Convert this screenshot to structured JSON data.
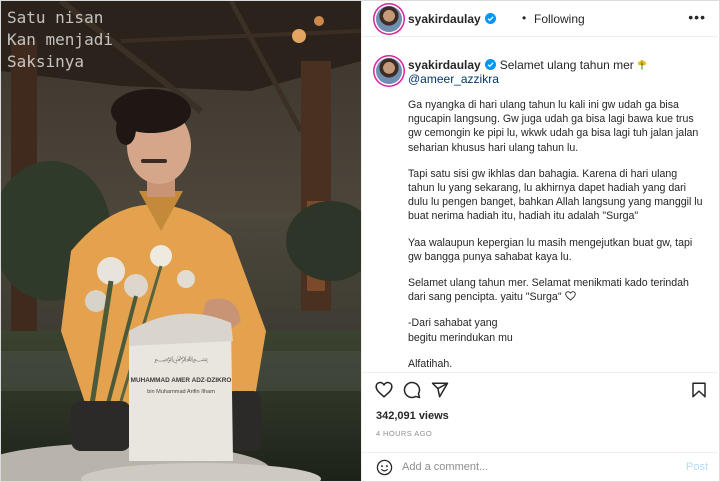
{
  "photo": {
    "overlay_text": "Satu nisan\nKan menjadi\nSaksinya",
    "gravestone_lines": [
      "MUHAMMAD AMER ADZ-DZIKRO",
      "bin Muhammad Arifin Ilham"
    ]
  },
  "header": {
    "username": "syakirdaulay",
    "separator": "•",
    "follow_status": "Following",
    "more": "•••"
  },
  "caption": {
    "username": "syakirdaulay",
    "first_line": "Selamet ulang tahun mer",
    "mention": "@ameer_azzikra",
    "paragraphs": [
      "Ga nyangka di hari ulang tahun lu kali ini gw udah ga bisa ngucapin langsung. Gw juga udah ga bisa lagi bawa kue trus gw cemongin ke pipi lu, wkwk udah ga bisa lagi tuh jalan jalan seharian khusus hari ulang tahun lu.",
      "Tapi satu sisi gw ikhlas dan bahagia. Karena di hari ulang tahun lu yang sekarang, lu akhirnya dapet hadiah yang dari dulu lu pengen banget, bahkan Allah langsung yang manggil lu buat nerima hadiah itu, hadiah itu adalah \"Surga\"",
      "Yaa walaupun kepergian lu masih mengejutkan buat gw, tapi gw bangga punya sahabat kaya lu.",
      "Selamet ulang tahun mer. Selamat menikmati kado terindah dari sang pencipta. yaitu \"Surga\"",
      "-Dari sahabat yang\nbegitu merindukan mu",
      "Alfatihah."
    ]
  },
  "stats": {
    "views": "342,091 views",
    "timestamp": "4 HOURS AGO"
  },
  "comment": {
    "placeholder": "Add a comment...",
    "post_label": "Post"
  },
  "colors": {
    "verified": "#0095f6",
    "mention": "#00376b",
    "post_disabled": "#b3dbff",
    "avatar_ring": "#d6249f"
  },
  "icons": [
    "verified-icon",
    "heart-icon",
    "comment-icon",
    "share-icon",
    "bookmark-icon",
    "emoji-icon",
    "flower-emoji-icon",
    "more-icon"
  ]
}
